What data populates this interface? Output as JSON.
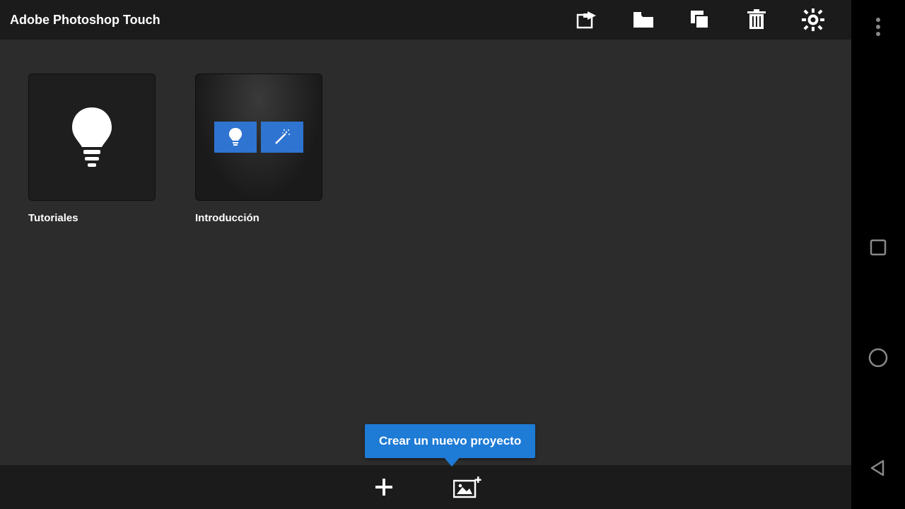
{
  "header": {
    "title": "Adobe Photoshop Touch"
  },
  "tiles": {
    "tutorials": {
      "label": "Tutoriales"
    },
    "introduction": {
      "label": "Introducción"
    }
  },
  "tooltip": {
    "text": "Crear un nuevo proyecto"
  },
  "icons": {
    "share": "share-icon",
    "folder": "folder-icon",
    "copy": "copy-icon",
    "trash": "trash-icon",
    "gear": "gear-icon",
    "lightbulb": "lightbulb-icon",
    "wand": "wand-icon",
    "plus": "plus-icon",
    "image_add": "image-add-icon",
    "overflow": "overflow-menu-icon",
    "recents": "recents-icon",
    "home": "home-icon",
    "back": "back-icon"
  },
  "colors": {
    "accent": "#1e7bd6",
    "accent2": "#2f74d0",
    "bar": "#1b1b1b",
    "bg": "#2c2c2c"
  }
}
